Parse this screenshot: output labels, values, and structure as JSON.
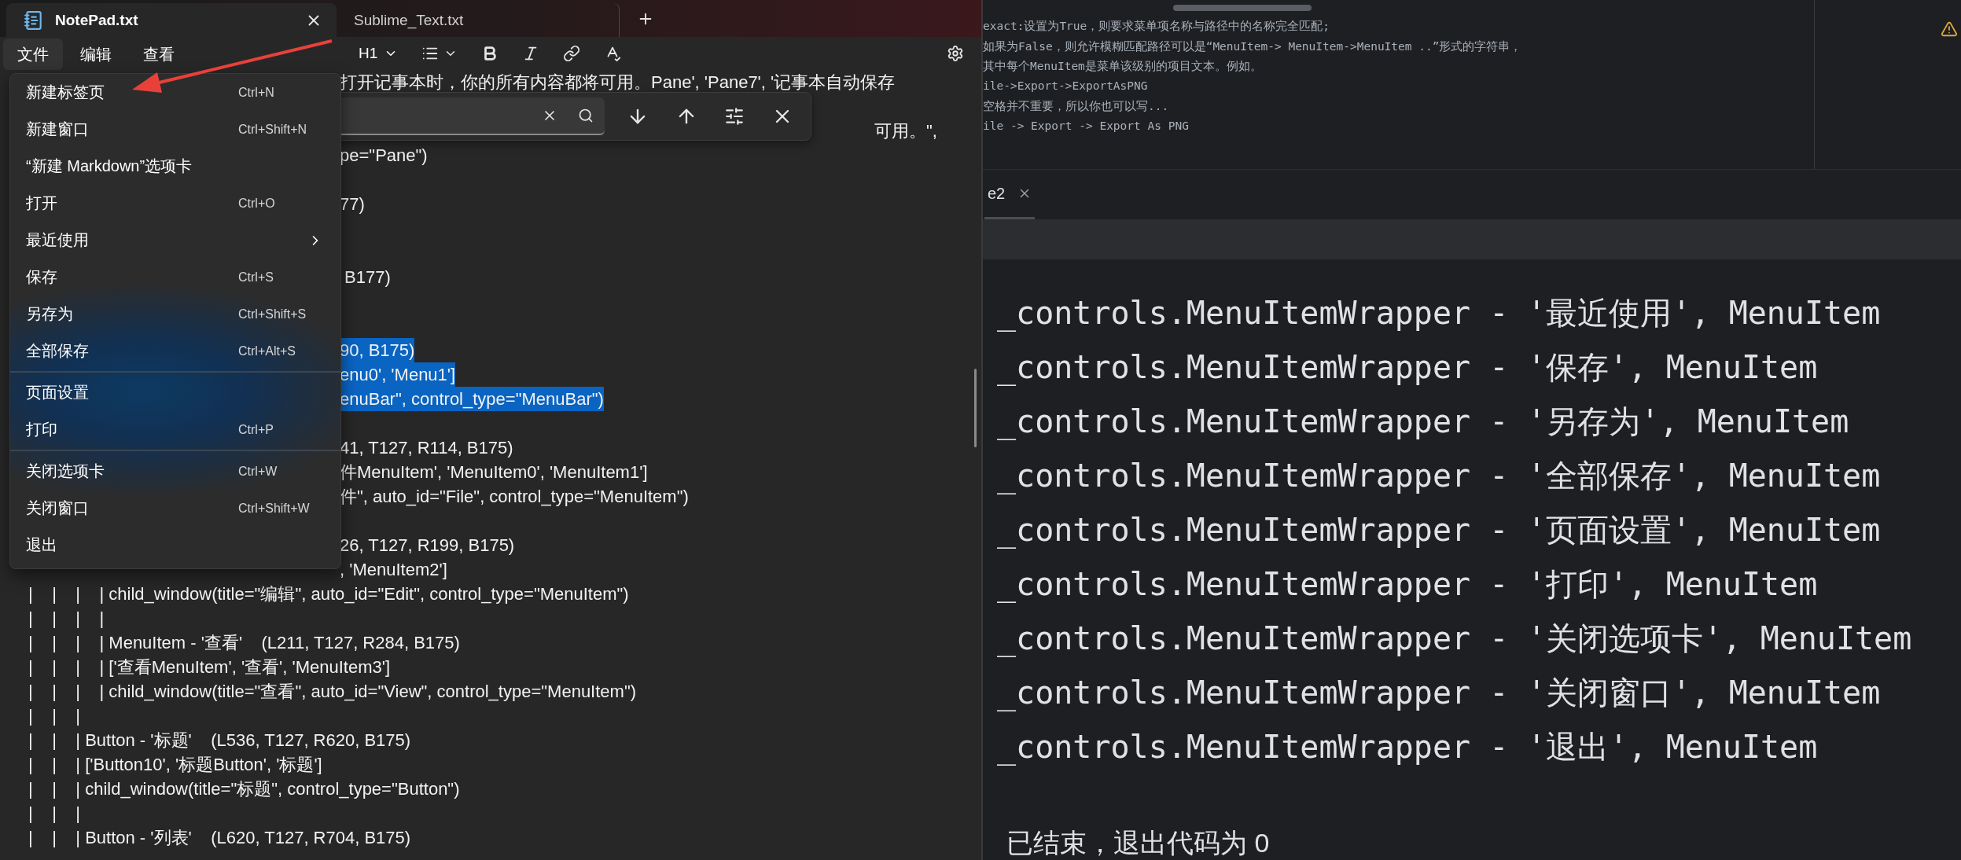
{
  "notepad": {
    "tabs": [
      {
        "title": "NotePad.txt",
        "selected": true
      },
      {
        "title": "Sublime_Text.txt",
        "selected": false
      }
    ],
    "menubar": [
      {
        "label": "文件",
        "selected": true
      },
      {
        "label": "编辑",
        "selected": false
      },
      {
        "label": "查看",
        "selected": false
      }
    ],
    "toolbar": {
      "heading": "H1"
    },
    "file_menu": [
      {
        "kind": "item",
        "label": "新建标签页",
        "shortcut": "Ctrl+N",
        "submenu": false
      },
      {
        "kind": "item",
        "label": "新建窗口",
        "shortcut": "Ctrl+Shift+N",
        "submenu": false
      },
      {
        "kind": "item",
        "label": "“新建 Markdown”选项卡",
        "submenu": false
      },
      {
        "kind": "item",
        "label": "打开",
        "shortcut": "Ctrl+O",
        "submenu": false
      },
      {
        "kind": "item",
        "label": "最近使用",
        "submenu": true
      },
      {
        "kind": "item",
        "label": "保存",
        "shortcut": "Ctrl+S",
        "submenu": false
      },
      {
        "kind": "item",
        "label": "另存为",
        "shortcut": "Ctrl+Shift+S",
        "submenu": false
      },
      {
        "kind": "item",
        "label": "全部保存",
        "shortcut": "Ctrl+Alt+S",
        "submenu": false
      },
      {
        "kind": "separator"
      },
      {
        "kind": "item",
        "label": "页面设置",
        "submenu": false
      },
      {
        "kind": "item",
        "label": "打印",
        "shortcut": "Ctrl+P",
        "submenu": false
      },
      {
        "kind": "separator"
      },
      {
        "kind": "item",
        "label": "关闭选项卡",
        "shortcut": "Ctrl+W",
        "submenu": false
      },
      {
        "kind": "item",
        "label": "关闭窗口",
        "shortcut": "Ctrl+Shift+W",
        "submenu": false
      },
      {
        "kind": "item",
        "label": "退出",
        "submenu": false
      }
    ],
    "editor_lines": [
      {
        "kind": "partial",
        "text": "打开记事本时，你的所有内容都将可用。Pane', 'Pane7', '记事本自动保存",
        "selected": false
      },
      {
        "kind": "blank"
      },
      {
        "kind": "after-find",
        "text": "可用。\",",
        "selected": false
      },
      {
        "kind": "partial",
        "text": "pe=\"Pane\")",
        "selected": false
      },
      {
        "kind": "blank"
      },
      {
        "kind": "partial",
        "text": "77)",
        "selected": false
      },
      {
        "kind": "blank"
      },
      {
        "kind": "blank"
      },
      {
        "kind": "partial",
        "text": " B177)",
        "selected": false
      },
      {
        "kind": "blank"
      },
      {
        "kind": "blank"
      },
      {
        "kind": "partial",
        "text": "90, B175)",
        "selected": true
      },
      {
        "kind": "partial",
        "text": "enu0', 'Menu1']",
        "selected": true
      },
      {
        "kind": "partial",
        "text": "enuBar\", control_type=\"MenuBar\")",
        "selected": true
      },
      {
        "kind": "blank"
      },
      {
        "kind": "partial",
        "text": "41, T127, R114, B175)",
        "selected": false
      },
      {
        "kind": "partial",
        "text": "件MenuItem', 'MenuItem0', 'MenuItem1']",
        "selected": false
      },
      {
        "kind": "partial",
        "text": "件\", auto_id=\"File\", control_type=\"MenuItem\")",
        "selected": false
      },
      {
        "kind": "blank"
      },
      {
        "kind": "partial",
        "text": "26, T127, R199, B175)",
        "selected": false
      },
      {
        "kind": "partial",
        "text": ", 'MenuItem2']",
        "selected": false
      },
      {
        "kind": "full",
        "text": "|    |    |    | child_window(title=\"编辑\", auto_id=\"Edit\", control_type=\"MenuItem\")",
        "selected": false
      },
      {
        "kind": "full",
        "text": "|    |    |    |",
        "selected": false
      },
      {
        "kind": "full",
        "text": "|    |    |    | MenuItem - '查看'    (L211, T127, R284, B175)",
        "selected": false
      },
      {
        "kind": "full",
        "text": "|    |    |    | ['查看MenuItem', '查看', 'MenuItem3']",
        "selected": false
      },
      {
        "kind": "full",
        "text": "|    |    |    | child_window(title=\"查看\", auto_id=\"View\", control_type=\"MenuItem\")",
        "selected": false
      },
      {
        "kind": "full",
        "text": "|    |    |",
        "selected": false
      },
      {
        "kind": "full",
        "text": "|    |    | Button - '标题'    (L536, T127, R620, B175)",
        "selected": false
      },
      {
        "kind": "full",
        "text": "|    |    | ['Button10', '标题Button', '标题']",
        "selected": false
      },
      {
        "kind": "full",
        "text": "|    |    | child_window(title=\"标题\", control_type=\"Button\")",
        "selected": false
      },
      {
        "kind": "full",
        "text": "|    |    |",
        "selected": false
      },
      {
        "kind": "full",
        "text": "|    |    | Button - '列表'    (L620, T127, R704, B175)",
        "selected": false
      }
    ]
  },
  "ide": {
    "code_lines": [
      "exact:设置为True，则要求菜单项名称与路径中的名称完全匹配;",
      "如果为False，则允许模糊匹配路径可以是“MenuItem-> MenuItem->MenuItem ..”形式的字符串，",
      "其中每个MenuItem是菜单该级别的项目文本。例如。",
      "ile->Export->ExportAsPNG",
      "空格并不重要，所以你也可以写...",
      "ile -> Export -> Export As PNG"
    ],
    "run_tab": {
      "label": "e2"
    },
    "console_lines": [
      "_controls.MenuItemWrapper - '最近使用', MenuItem",
      "_controls.MenuItemWrapper - '保存', MenuItem",
      "_controls.MenuItemWrapper - '另存为', MenuItem",
      "_controls.MenuItemWrapper - '全部保存', MenuItem",
      "_controls.MenuItemWrapper - '页面设置', MenuItem",
      "_controls.MenuItemWrapper - '打印', MenuItem",
      "_controls.MenuItemWrapper - '关闭选项卡', MenuItem",
      "_controls.MenuItemWrapper - '关闭窗口', MenuItem",
      "_controls.MenuItemWrapper - '退出', MenuItem"
    ],
    "exit_message": "已结束，退出代码为 0"
  }
}
